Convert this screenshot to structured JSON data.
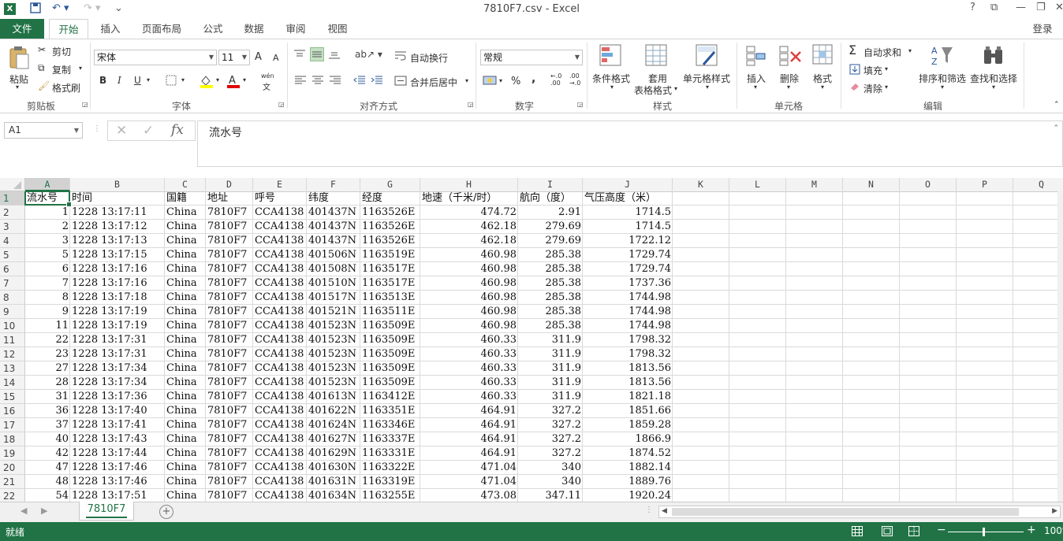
{
  "window": {
    "title": "7810F7.csv - Excel",
    "help": "?",
    "account": "登录"
  },
  "tabs": [
    "文件",
    "开始",
    "插入",
    "页面布局",
    "公式",
    "数据",
    "审阅",
    "视图"
  ],
  "ribbon": {
    "clipboard": {
      "paste": "粘贴",
      "cut": "剪切",
      "copy": "复制",
      "format_painter": "格式刷",
      "label": "剪贴板"
    },
    "font": {
      "name": "宋体",
      "size": "11",
      "bold": "B",
      "italic": "I",
      "underline": "U",
      "grow": "A",
      "shrink": "A",
      "phonetic": "wén",
      "label": "字体"
    },
    "alignment": {
      "wrap": "自动换行",
      "merge": "合并后居中",
      "label": "对齐方式"
    },
    "number": {
      "format": "常规",
      "percent": "%",
      "comma": ",",
      "inc_dec": "←.0\n.00",
      "dec_dec": ".00\n→.0",
      "label": "数字"
    },
    "styles": {
      "conditional": "条件格式",
      "table_line1": "套用",
      "table_line2": "表格格式",
      "cell_styles": "单元格样式",
      "label": "样式"
    },
    "cells": {
      "insert": "插入",
      "delete": "删除",
      "format": "格式",
      "label": "单元格"
    },
    "editing": {
      "autosum": "自动求和",
      "fill": "填充",
      "clear": "清除",
      "sort": "排序和筛选",
      "find": "查找和选择",
      "label": "编辑"
    }
  },
  "formula_bar": {
    "name_box": "A1",
    "fx": "fx",
    "content": "流水号"
  },
  "columns": [
    "A",
    "B",
    "C",
    "D",
    "E",
    "F",
    "G",
    "H",
    "I",
    "J",
    "K",
    "L",
    "M",
    "N",
    "O",
    "P",
    "Q"
  ],
  "rows": [
    [
      "流水号",
      "时间",
      "国籍",
      "地址",
      "呼号",
      "纬度",
      "经度",
      "地速（千米/时）",
      "航向（度）",
      "气压高度（米）"
    ],
    [
      "1",
      "1228 13:17:11",
      "China",
      "7810F7",
      "CCA4138",
      "401437N",
      "1163526E",
      "474.72",
      "2.91",
      "1714.5"
    ],
    [
      "2",
      "1228 13:17:12",
      "China",
      "7810F7",
      "CCA4138",
      "401437N",
      "1163526E",
      "462.18",
      "279.69",
      "1714.5"
    ],
    [
      "3",
      "1228 13:17:13",
      "China",
      "7810F7",
      "CCA4138",
      "401437N",
      "1163526E",
      "462.18",
      "279.69",
      "1722.12"
    ],
    [
      "5",
      "1228 13:17:15",
      "China",
      "7810F7",
      "CCA4138",
      "401506N",
      "1163519E",
      "460.98",
      "285.38",
      "1729.74"
    ],
    [
      "6",
      "1228 13:17:16",
      "China",
      "7810F7",
      "CCA4138",
      "401508N",
      "1163517E",
      "460.98",
      "285.38",
      "1729.74"
    ],
    [
      "7",
      "1228 13:17:16",
      "China",
      "7810F7",
      "CCA4138",
      "401510N",
      "1163517E",
      "460.98",
      "285.38",
      "1737.36"
    ],
    [
      "8",
      "1228 13:17:18",
      "China",
      "7810F7",
      "CCA4138",
      "401517N",
      "1163513E",
      "460.98",
      "285.38",
      "1744.98"
    ],
    [
      "9",
      "1228 13:17:19",
      "China",
      "7810F7",
      "CCA4138",
      "401521N",
      "1163511E",
      "460.98",
      "285.38",
      "1744.98"
    ],
    [
      "11",
      "1228 13:17:19",
      "China",
      "7810F7",
      "CCA4138",
      "401523N",
      "1163509E",
      "460.98",
      "285.38",
      "1744.98"
    ],
    [
      "22",
      "1228 13:17:31",
      "China",
      "7810F7",
      "CCA4138",
      "401523N",
      "1163509E",
      "460.33",
      "311.9",
      "1798.32"
    ],
    [
      "23",
      "1228 13:17:31",
      "China",
      "7810F7",
      "CCA4138",
      "401523N",
      "1163509E",
      "460.33",
      "311.9",
      "1798.32"
    ],
    [
      "27",
      "1228 13:17:34",
      "China",
      "7810F7",
      "CCA4138",
      "401523N",
      "1163509E",
      "460.33",
      "311.9",
      "1813.56"
    ],
    [
      "28",
      "1228 13:17:34",
      "China",
      "7810F7",
      "CCA4138",
      "401523N",
      "1163509E",
      "460.33",
      "311.9",
      "1813.56"
    ],
    [
      "31",
      "1228 13:17:36",
      "China",
      "7810F7",
      "CCA4138",
      "401613N",
      "1163412E",
      "460.33",
      "311.9",
      "1821.18"
    ],
    [
      "36",
      "1228 13:17:40",
      "China",
      "7810F7",
      "CCA4138",
      "401622N",
      "1163351E",
      "464.91",
      "327.2",
      "1851.66"
    ],
    [
      "37",
      "1228 13:17:41",
      "China",
      "7810F7",
      "CCA4138",
      "401624N",
      "1163346E",
      "464.91",
      "327.2",
      "1859.28"
    ],
    [
      "40",
      "1228 13:17:43",
      "China",
      "7810F7",
      "CCA4138",
      "401627N",
      "1163337E",
      "464.91",
      "327.2",
      "1866.9"
    ],
    [
      "42",
      "1228 13:17:44",
      "China",
      "7810F7",
      "CCA4138",
      "401629N",
      "1163331E",
      "464.91",
      "327.2",
      "1874.52"
    ],
    [
      "47",
      "1228 13:17:46",
      "China",
      "7810F7",
      "CCA4138",
      "401630N",
      "1163322E",
      "471.04",
      "340",
      "1882.14"
    ],
    [
      "48",
      "1228 13:17:46",
      "China",
      "7810F7",
      "CCA4138",
      "401631N",
      "1163319E",
      "471.04",
      "340",
      "1889.76"
    ],
    [
      "54",
      "1228 13:17:51",
      "China",
      "7810F7",
      "CCA4138",
      "401634N",
      "1163255E",
      "473.08",
      "347.11",
      "1920.24"
    ]
  ],
  "sheet_tab": "7810F7",
  "status": {
    "ready": "就绪",
    "zoom": "100%"
  },
  "colors": {
    "excel_green": "#217346"
  }
}
